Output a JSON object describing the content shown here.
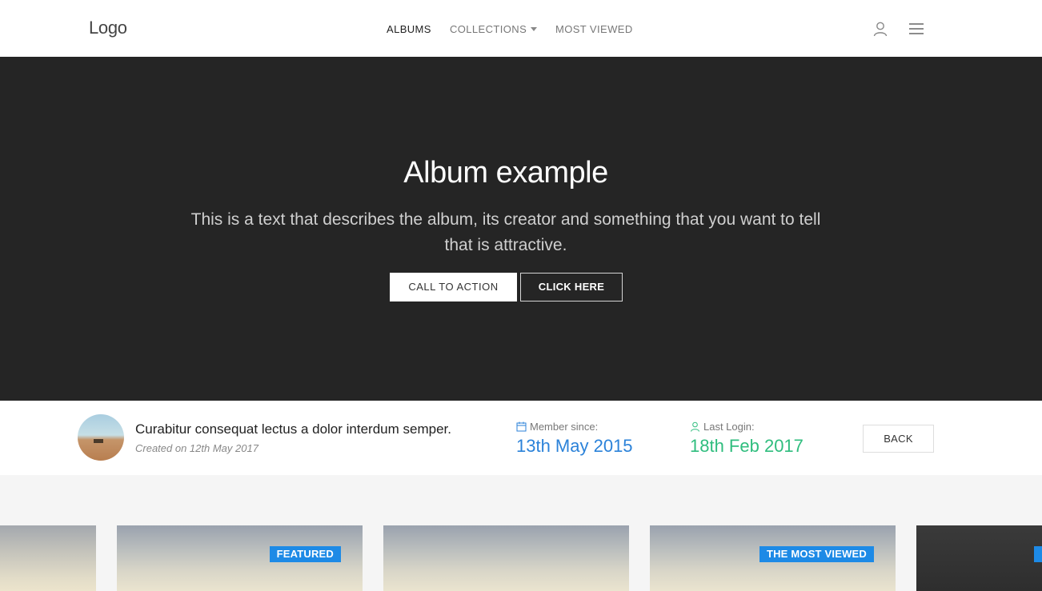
{
  "navbar": {
    "logo": "Logo",
    "links": [
      {
        "label": "ALBUMS"
      },
      {
        "label": "COLLECTIONS"
      },
      {
        "label": "MOST VIEWED"
      }
    ],
    "user_icon": "user-icon",
    "menu_icon": "hamburger-menu-icon"
  },
  "hero": {
    "title": "Album example",
    "text": "This is a text that describes the album, its creator and something that you want to tell that is attractive.",
    "cta_label": "CALL TO ACTION",
    "click_label": "CLICK HERE"
  },
  "info": {
    "description": "Curabitur consequat lectus a dolor interdum semper.",
    "created": "Created on 12th May 2017",
    "member_label": "Member since:",
    "member_value": "13th May 2015",
    "login_label": "Last Login:",
    "login_value": "18th Feb 2017",
    "back_label": "BACK"
  },
  "gallery": {
    "cards": [
      {
        "badge": ""
      },
      {
        "badge": "FEATURED"
      },
      {
        "badge": ""
      },
      {
        "badge": "THE MOST VIEWED"
      },
      {
        "badge": ""
      }
    ]
  },
  "colors": {
    "hero_bg": "#252525",
    "accent_blue": "#2b82d9",
    "accent_green": "#2fbd7e",
    "badge_blue": "#1d8ae6"
  }
}
